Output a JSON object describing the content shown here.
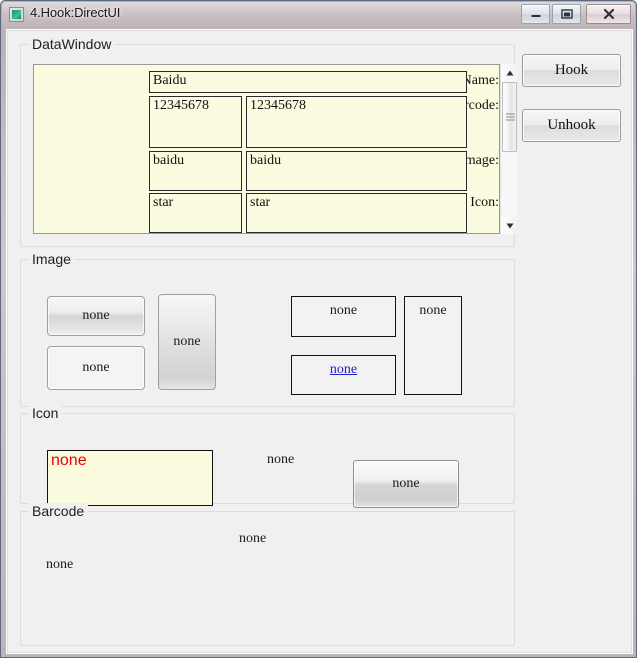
{
  "window": {
    "title": "4.Hook:DirectUI",
    "app_icon": "app-icon",
    "controls": {
      "minimize": "minimize-button",
      "maximize": "maximize-button",
      "close": "close-button"
    }
  },
  "groups": {
    "datawindow": {
      "title": "DataWindow"
    },
    "image": {
      "title": "Image"
    },
    "icon": {
      "title": "Icon"
    },
    "barcode": {
      "title": "Barcode"
    }
  },
  "datawindow": {
    "rows": [
      {
        "label": "Name:",
        "value_1": "Baidu",
        "value_2": ""
      },
      {
        "label": "Barcode:",
        "value_1": "12345678",
        "value_2": "12345678"
      },
      {
        "label": "Image:",
        "value_1": "baidu",
        "value_2": "baidu"
      },
      {
        "label": "Icon:",
        "value_1": "star",
        "value_2": "star"
      }
    ],
    "scrollbar": {
      "up_arrow": "scroll-up-arrow",
      "down_arrow": "scroll-down-arrow",
      "thumb": "scroll-thumb"
    }
  },
  "side_buttons": {
    "hook": "Hook",
    "unhook": "Unhook"
  },
  "image_section": {
    "button_1": "none",
    "button_2": "none",
    "button_3": "none",
    "panel_1": "none",
    "panel_2_link": "none",
    "panel_3": "none"
  },
  "icon_section": {
    "textbox_value": "none",
    "label": "none",
    "button": "none"
  },
  "barcode_section": {
    "label_1": "none",
    "label_2": "none"
  },
  "colors": {
    "client_background": "#f0f0f0",
    "field_background": "#fbfbdf",
    "alert_text": "#ee0000",
    "link_text": "#2020cc",
    "group_border": "#dcdcdc"
  }
}
